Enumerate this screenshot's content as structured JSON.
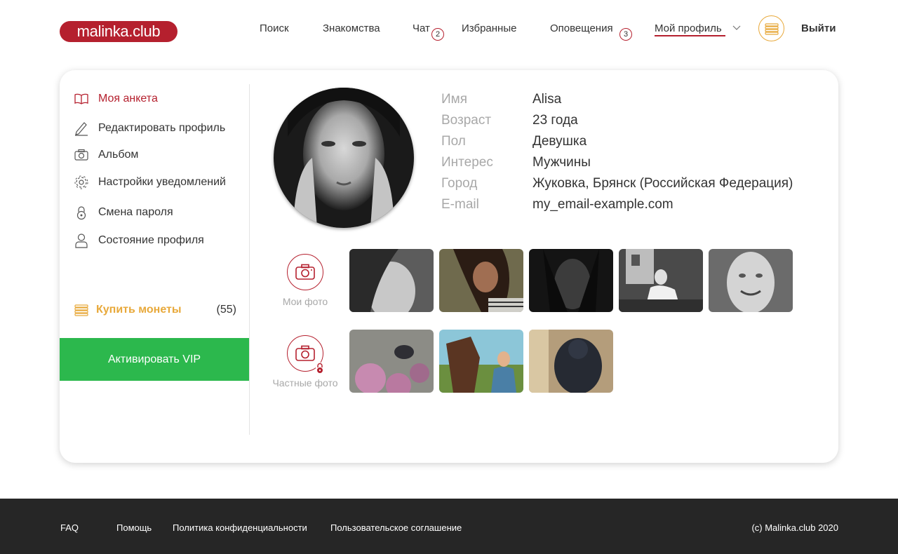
{
  "header": {
    "logo_text": "malinka.club",
    "nav": {
      "search": "Поиск",
      "dating": "Знакомства",
      "chat": "Чат",
      "chat_badge": "2",
      "favorites": "Избранные",
      "notifications": "Оповещения",
      "notifications_badge": "3",
      "my_profile": "Мой профиль"
    },
    "logout": "Выйти"
  },
  "sidebar": {
    "items": [
      {
        "label": "Моя анкета",
        "icon": "book-icon"
      },
      {
        "label": "Редактировать профиль",
        "icon": "pencil-icon"
      },
      {
        "label": "Альбом",
        "icon": "camera-icon"
      },
      {
        "label": "Настройки уведомлений",
        "icon": "gear-icon"
      },
      {
        "label": "Смена пароля",
        "icon": "lock-icon"
      },
      {
        "label": "Состояние профиля",
        "icon": "user-icon"
      }
    ],
    "buy_coins": "Купить монеты",
    "coins_count": "(55)",
    "vip_button": "Активировать VIP"
  },
  "profile": {
    "fields": [
      {
        "label": "Имя",
        "value": "Alisa"
      },
      {
        "label": "Возраст",
        "value": "23 года"
      },
      {
        "label": "Пол",
        "value": "Девушка"
      },
      {
        "label": "Интерес",
        "value": "Мужчины"
      },
      {
        "label": "Город",
        "value": "Жуковка, Брянск (Российская Федерация)"
      },
      {
        "label": "E-mail",
        "value": "my_email-example.com"
      }
    ]
  },
  "photos": {
    "my_photos_label": "Мои фото",
    "private_photos_label": "Частные фото"
  },
  "footer": {
    "faq": "FAQ",
    "help": "Помощь",
    "privacy": "Политика конфиденциальности",
    "agreement": "Пользовательское соглашение",
    "copyright": "(c) Malinka.club 2020"
  },
  "colors": {
    "brand": "#b5202e",
    "coins": "#e8a93b",
    "vip": "#2cb84d",
    "footer_bg": "#262626"
  }
}
